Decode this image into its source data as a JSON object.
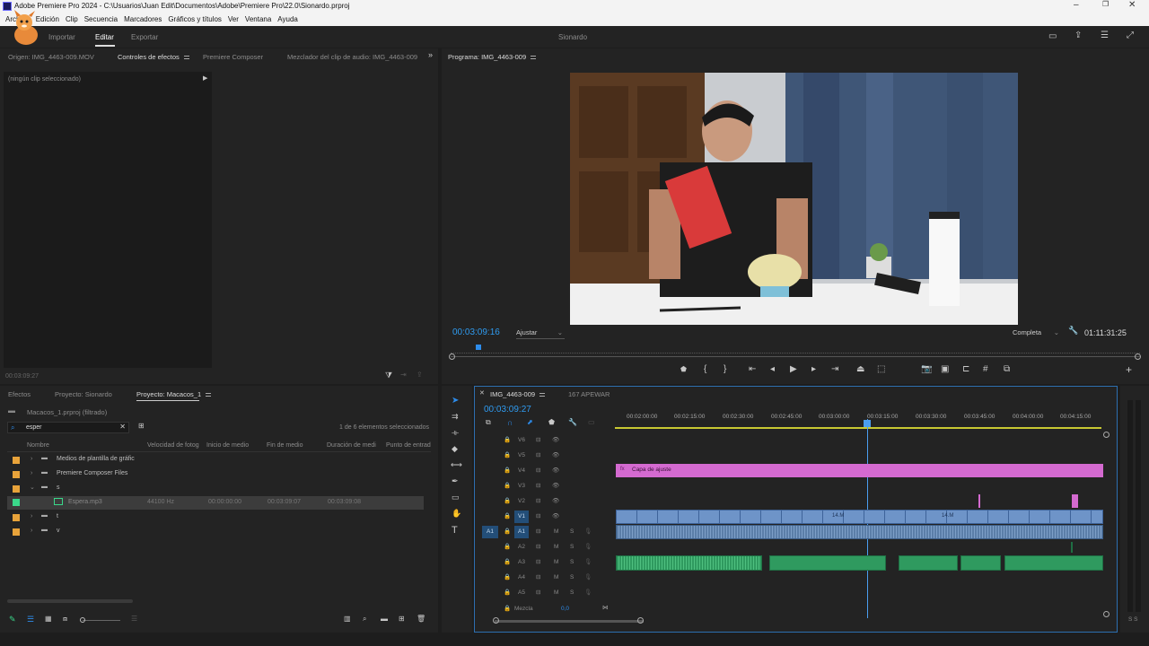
{
  "titlebar": {
    "title": "Adobe Premiere Pro 2024 - C:\\Usuarios\\Juan Edit\\Documentos\\Adobe\\Premiere Pro\\22.0\\Sionardo.prproj"
  },
  "menu": {
    "items": [
      "Archivo",
      "Edición",
      "Clip",
      "Secuencia",
      "Marcadores",
      "Gráficos y títulos",
      "Ver",
      "Ventana",
      "Ayuda"
    ]
  },
  "workspace": {
    "tabs": [
      "Importar",
      "Editar",
      "Exportar"
    ],
    "active": "Editar",
    "project_name": "Sionardo"
  },
  "source_panel": {
    "tabs": [
      "Origen: IMG_4463-009.MOV",
      "Controles de efectos",
      "Premiere Composer",
      "Mezclador del clip de audio: IMG_4463-009"
    ],
    "no_clip": "(ningún clip seleccionado)",
    "timecode": "00:03:09:27"
  },
  "program_monitor": {
    "tab": "Programa: IMG_4463-009",
    "timecode": "00:03:09:16",
    "fit": "Ajustar",
    "quality": "Completa",
    "duration": "01:11:31:25"
  },
  "project_panel": {
    "tabs": [
      "Efectos",
      "Proyecto: Sionardo",
      "Proyecto: Macacos_1"
    ],
    "path": "Macacos_1.prproj (filtrado)",
    "search_value": "esper",
    "selection_count": "1 de 6 elementos seleccionados",
    "columns": [
      "Nombre",
      "Velocidad de fotog",
      "Inicio de medio",
      "Fin de medio",
      "Duración de medi",
      "Punto de entrad"
    ],
    "rows": [
      {
        "name": "Medios de plantilla de gráfic",
        "color": "#e8a33a",
        "fps": "",
        "start": "",
        "end": "",
        "dur": ""
      },
      {
        "name": "Premiere Composer Files",
        "color": "#e8a33a",
        "fps": "",
        "start": "",
        "end": "",
        "dur": ""
      },
      {
        "name": "s",
        "color": "#e8a33a",
        "fps": "",
        "start": "",
        "end": "",
        "dur": ""
      },
      {
        "name": "Espera.mp3",
        "color": "#3ad88a",
        "fps": "44100 Hz",
        "start": "00:00:00:00",
        "end": "00:03:09:07",
        "dur": "00:03:09:08"
      },
      {
        "name": "t",
        "color": "#e8a33a",
        "fps": "",
        "start": "",
        "end": "",
        "dur": ""
      },
      {
        "name": "v",
        "color": "#e8a33a",
        "fps": "",
        "start": "",
        "end": "",
        "dur": ""
      }
    ]
  },
  "timeline": {
    "tabs": [
      "IMG_4463-009",
      "167 APEWAR"
    ],
    "timecode": "00:03:09:27",
    "ruler": [
      "00:02:00:00",
      "00:02:15:00",
      "00:02:30:00",
      "00:02:45:00",
      "00:03:00:00",
      "00:03:15:00",
      "00:03:30:00",
      "00:03:45:00",
      "00:04:00:00",
      "00:04:15:00"
    ],
    "video_tracks": [
      "V6",
      "V5",
      "V4",
      "V3",
      "V2",
      "V1"
    ],
    "audio_tracks": [
      "A1",
      "A2",
      "A3",
      "A4",
      "A5"
    ],
    "adjustment_clip": "Capa de ajuste",
    "clip_label": "14.M",
    "mix_label": "Mezcla",
    "mix_value": "0,0",
    "m_label": "M",
    "s_label": "S",
    "src_patch_a": "A1",
    "meter_label": "S S"
  },
  "colors": {
    "accent": "#2d8ceb",
    "adjustment": "#d46ad0",
    "audio_green": "#2f9a5f",
    "video_blue": "#6e94c8"
  }
}
